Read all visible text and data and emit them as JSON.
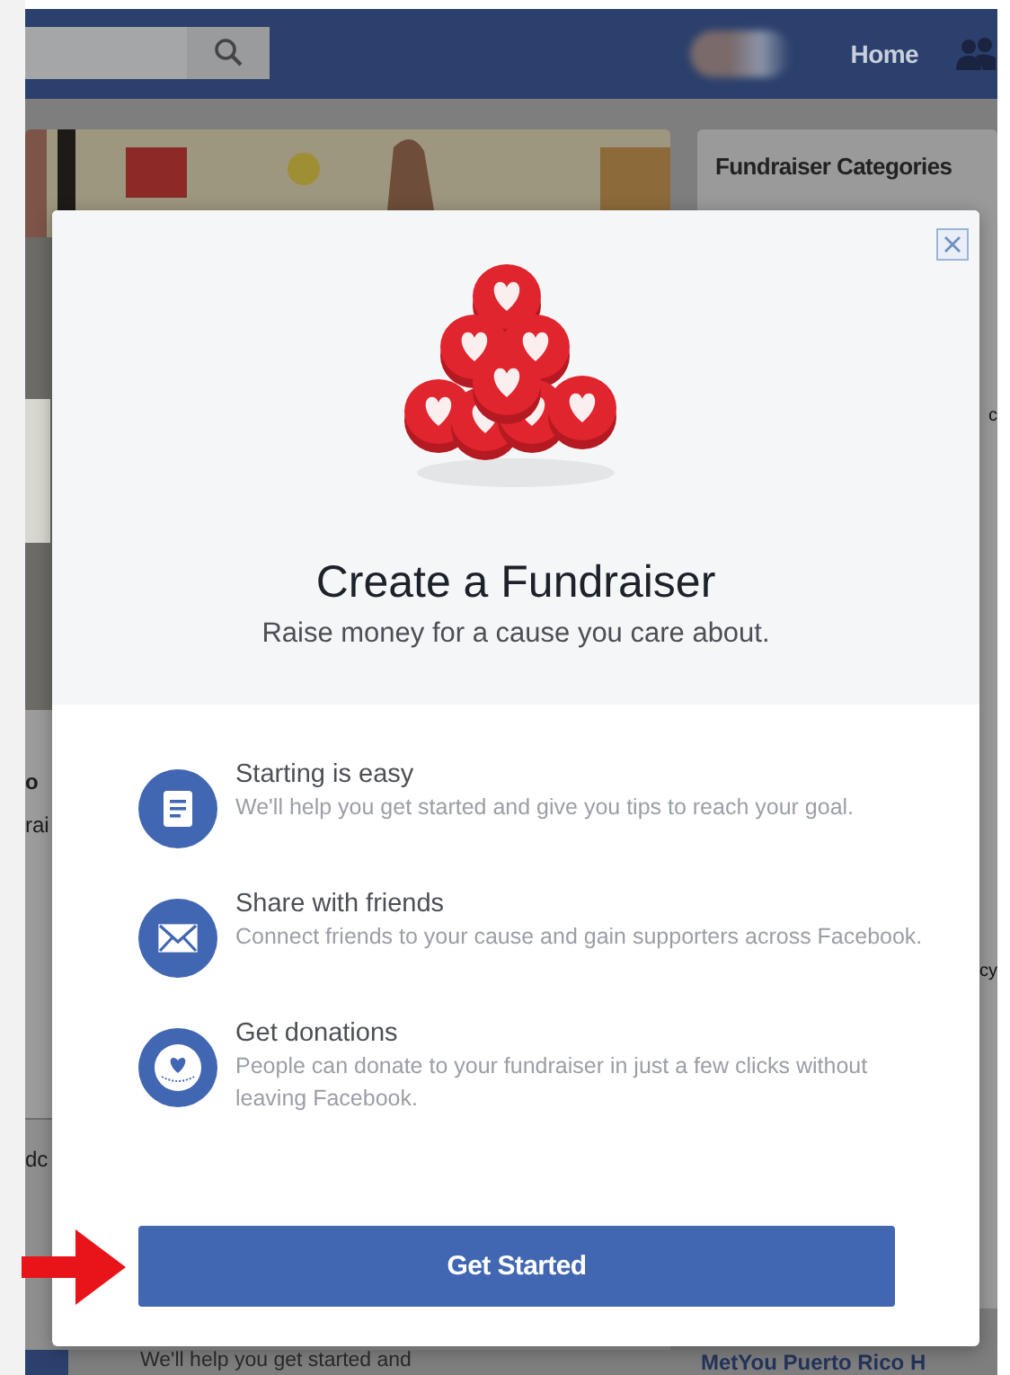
{
  "header": {
    "home_link": "Home"
  },
  "left_column": {
    "card_fragments": [
      "o",
      "rai"
    ],
    "lower_fragment": "dc",
    "bottom_text": "We'll help you get started and"
  },
  "right_column": {
    "title": "Fundraiser Categories",
    "fragments": [
      "c",
      "cy"
    ],
    "bottom_link": "MetYou Puerto Rico H"
  },
  "dialog": {
    "title": "Create a Fundraiser",
    "subtitle": "Raise money for a cause you care about.",
    "features": [
      {
        "kind": "document",
        "title": "Starting is easy",
        "description": "We'll help you get started and give you tips to reach your goal."
      },
      {
        "kind": "envelope",
        "title": "Share with friends",
        "description": "Connect friends to your cause and gain supporters across Facebook."
      },
      {
        "kind": "heart",
        "title": "Get donations",
        "description": "People can donate to your fundraiser in just a few clicks without leaving Facebook."
      }
    ],
    "button": "Get Started"
  }
}
